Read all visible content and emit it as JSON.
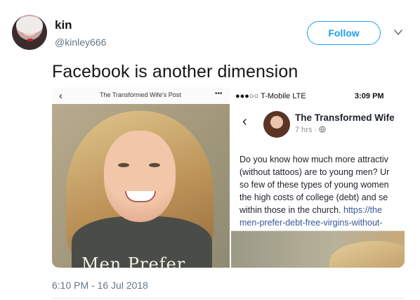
{
  "user": {
    "display_name": "kin",
    "handle": "@kinley666"
  },
  "actions": {
    "follow_label": "Follow",
    "caret_icon": "chevron-down-icon"
  },
  "tweet": {
    "text": "Facebook is another dimension",
    "timestamp": "6:10 PM - 16 Jul 2018"
  },
  "media": {
    "left": {
      "back_glyph": "‹",
      "title": "The Transformed Wife's Post",
      "more_glyph": "•••",
      "overlay_text": "Men Prefer"
    },
    "right": {
      "carrier": "●●●○○ T-Mobile  LTE",
      "time": "3:09 PM",
      "back_glyph": "‹",
      "page_name": "The Transformed Wife",
      "meta": "7 hrs · ",
      "lines": [
        "Do you know how much more attractiv",
        "(without tattoos) are to young men? Ur",
        "so few of these types of young women",
        "the high costs of college (debt) and se",
        "within those in the church. "
      ],
      "link_start": "https://the",
      "link_end": "men-prefer-debt-free-virgins-without-"
    }
  },
  "colors": {
    "accent": "#1da1f2",
    "secondary_text": "#657786",
    "fb_link": "#365899"
  }
}
